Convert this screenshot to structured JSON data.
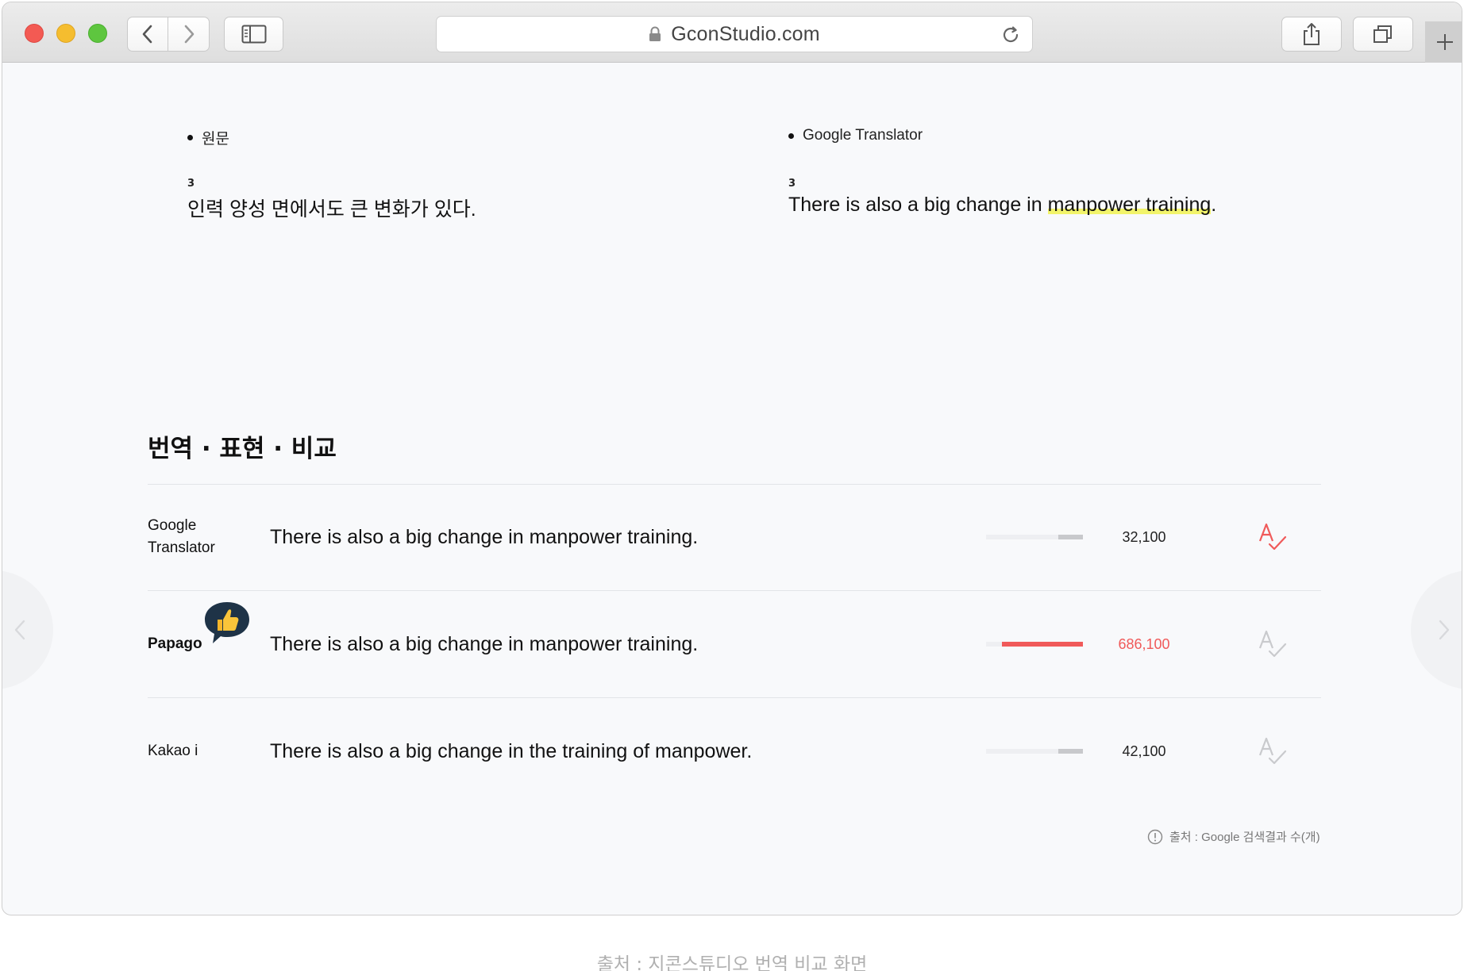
{
  "browser": {
    "url": "GconStudio.com"
  },
  "columns": {
    "left": {
      "label": "원문",
      "number": "3",
      "sentence": "인력 양성 면에서도 큰 변화가 있다."
    },
    "right": {
      "label": "Google Translator",
      "number": "3",
      "sentence_before": "There is also a big change in ",
      "sentence_highlight": "manpower training",
      "sentence_after": "."
    }
  },
  "comparison": {
    "title": "번역 · 표현 · 비교",
    "rows": [
      {
        "engine_line1": "Google",
        "engine_line2": "Translator",
        "translation": "There is also a big change in manpower training.",
        "count": "32,100",
        "count_value": 32100,
        "spell_color": "#f05a5a"
      },
      {
        "engine_line1": "Papago",
        "engine_line2": "",
        "translation": "There is also a big change in manpower training.",
        "count": "686,100",
        "count_value": 686100,
        "spell_color": "#c9cacd"
      },
      {
        "engine_line1": "Kakao i",
        "engine_line2": "",
        "translation": "There is also a big change in the training of manpower.",
        "count": "42,100",
        "count_value": 42100,
        "spell_color": "#c9cacd"
      }
    ],
    "source_note": "출처 : Google 검색결과 수(개)"
  },
  "caption": "출처 : 지콘스튜디오 번역 비교 화면",
  "colors": {
    "accent": "#f05a5a",
    "highlight": "#f2f46b",
    "badge": "#1e3347"
  }
}
